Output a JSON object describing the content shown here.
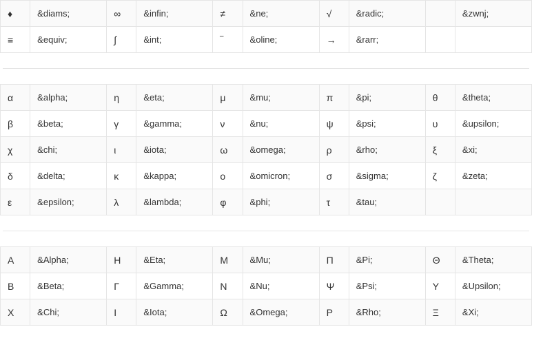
{
  "tables": [
    {
      "rows": [
        [
          {
            "sym": "♦",
            "code": "&diams;"
          },
          {
            "sym": "∞",
            "code": "&infin;"
          },
          {
            "sym": "≠",
            "code": "&ne;"
          },
          {
            "sym": "√",
            "code": "&radic;"
          },
          {
            "sym": "",
            "code": "&zwnj;"
          }
        ],
        [
          {
            "sym": "≡",
            "code": "&equiv;"
          },
          {
            "sym": "∫",
            "code": "&int;"
          },
          {
            "sym": "‾",
            "code": "&oline;"
          },
          {
            "sym": "→",
            "code": "&rarr;"
          },
          {
            "sym": "",
            "code": ""
          }
        ]
      ]
    },
    {
      "rows": [
        [
          {
            "sym": "α",
            "code": "&alpha;"
          },
          {
            "sym": "η",
            "code": "&eta;"
          },
          {
            "sym": "μ",
            "code": "&mu;"
          },
          {
            "sym": "π",
            "code": "&pi;"
          },
          {
            "sym": "θ",
            "code": "&theta;"
          }
        ],
        [
          {
            "sym": "β",
            "code": "&beta;"
          },
          {
            "sym": "γ",
            "code": "&gamma;"
          },
          {
            "sym": "ν",
            "code": "&nu;"
          },
          {
            "sym": "ψ",
            "code": "&psi;"
          },
          {
            "sym": "υ",
            "code": "&upsilon;"
          }
        ],
        [
          {
            "sym": "χ",
            "code": "&chi;"
          },
          {
            "sym": "ι",
            "code": "&iota;"
          },
          {
            "sym": "ω",
            "code": "&omega;"
          },
          {
            "sym": "ρ",
            "code": "&rho;"
          },
          {
            "sym": "ξ",
            "code": "&xi;"
          }
        ],
        [
          {
            "sym": "δ",
            "code": "&delta;"
          },
          {
            "sym": "κ",
            "code": "&kappa;"
          },
          {
            "sym": "ο",
            "code": "&omicron;"
          },
          {
            "sym": "σ",
            "code": "&sigma;"
          },
          {
            "sym": "ζ",
            "code": "&zeta;"
          }
        ],
        [
          {
            "sym": "ε",
            "code": "&epsilon;"
          },
          {
            "sym": "λ",
            "code": "&lambda;"
          },
          {
            "sym": "φ",
            "code": "&phi;"
          },
          {
            "sym": "τ",
            "code": "&tau;"
          },
          {
            "sym": "",
            "code": ""
          }
        ]
      ]
    },
    {
      "rows": [
        [
          {
            "sym": "Α",
            "code": "&Alpha;"
          },
          {
            "sym": "Η",
            "code": "&Eta;"
          },
          {
            "sym": "Μ",
            "code": "&Mu;"
          },
          {
            "sym": "Π",
            "code": "&Pi;"
          },
          {
            "sym": "Θ",
            "code": "&Theta;"
          }
        ],
        [
          {
            "sym": "Β",
            "code": "&Beta;"
          },
          {
            "sym": "Γ",
            "code": "&Gamma;"
          },
          {
            "sym": "Ν",
            "code": "&Nu;"
          },
          {
            "sym": "Ψ",
            "code": "&Psi;"
          },
          {
            "sym": "Υ",
            "code": "&Upsilon;"
          }
        ],
        [
          {
            "sym": "Χ",
            "code": "&Chi;"
          },
          {
            "sym": "Ι",
            "code": "&Iota;"
          },
          {
            "sym": "Ω",
            "code": "&Omega;"
          },
          {
            "sym": "Ρ",
            "code": "&Rho;"
          },
          {
            "sym": "Ξ",
            "code": "&Xi;"
          }
        ]
      ]
    }
  ]
}
